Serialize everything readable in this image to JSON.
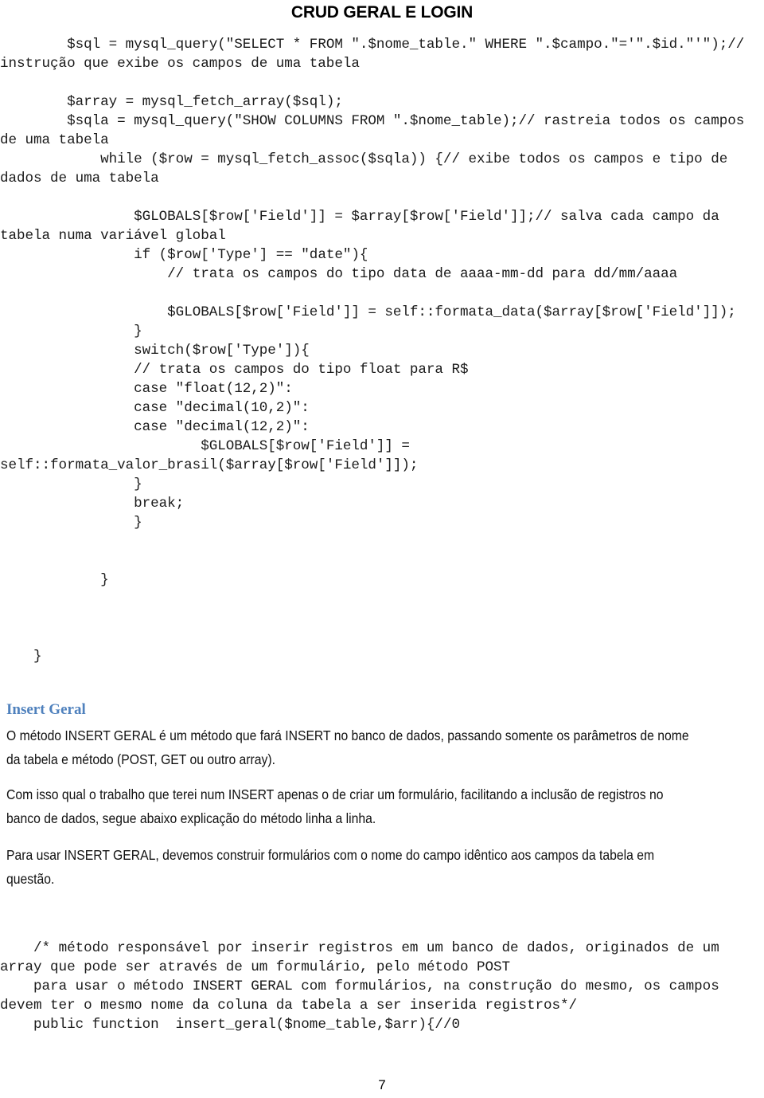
{
  "document": {
    "title": "CRUD GERAL E LOGIN",
    "page_number": "7",
    "heading_color": "#4F81BD"
  },
  "code_block_1": {
    "lines": [
      "        $sql = mysql_query(\"SELECT * FROM \".$nome_table.\" WHERE \".$campo.\"='\".$id.\"'\");// instrução que exibe os campos de uma tabela",
      "",
      "        $array = mysql_fetch_array($sql);",
      "        $sqla = mysql_query(\"SHOW COLUMNS FROM \".$nome_table);// rastreia todos os campos de uma tabela",
      "            while ($row = mysql_fetch_assoc($sqla)) {// exibe todos os campos e tipo de dados de uma tabela",
      "",
      "                $GLOBALS[$row['Field']] = $array[$row['Field']];// salva cada campo da tabela numa variável global",
      "                if ($row['Type'] == \"date\"){",
      "                    // trata os campos do tipo data de aaaa-mm-dd para dd/mm/aaaa",
      "",
      "                    $GLOBALS[$row['Field']] = self::formata_data($array[$row['Field']]);",
      "                }",
      "                switch($row['Type']){",
      "                // trata os campos do tipo float para R$",
      "                case \"float(12,2)\":",
      "                case \"decimal(10,2)\":",
      "                case \"decimal(12,2)\":",
      "                        $GLOBALS[$row['Field']] = self::formata_valor_brasil($array[$row['Field']]);",
      "                }",
      "                break;",
      "                }",
      "",
      "",
      "            }",
      "",
      "",
      "",
      "    }"
    ]
  },
  "section": {
    "heading": "Insert Geral",
    "paragraph_1": "O método INSERT GERAL é um método que fará INSERT no banco de dados, passando somente os parâmetros de nome da tabela e método (POST, GET ou outro array).",
    "paragraph_2": "Com isso qual o trabalho que terei num INSERT apenas o de criar um formulário, facilitando a inclusão de registros no banco de dados, segue abaixo explicação do método linha a linha.",
    "paragraph_3": "Para usar INSERT GERAL, devemos construir formulários com o nome do campo idêntico aos campos da tabela em questão."
  },
  "code_block_2": {
    "lines": [
      "    /* método responsável por inserir registros em um banco de dados, originados de um array que pode ser através de um formulário, pelo método POST",
      "    para usar o método INSERT GERAL com formulários, na construção do mesmo, os campos devem ter o mesmo nome da coluna da tabela a ser inserida registros*/",
      "    public function  insert_geral($nome_table,$arr){//0"
    ]
  }
}
